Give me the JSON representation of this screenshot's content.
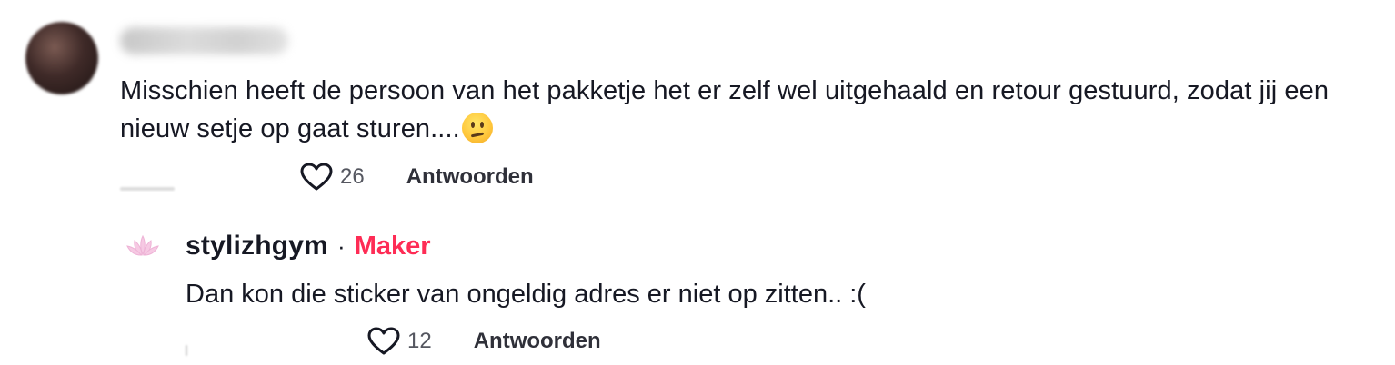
{
  "comment": {
    "text_main": "Misschien heeft de persoon van het pakketje het er zelf wel uitgehaald en retour gestuurd, zodat jij een nieuw setje op gaat sturen....",
    "emoji": "confused-face",
    "likes": "26",
    "reply_label": "Antwoorden"
  },
  "reply": {
    "username": "stylizhgym",
    "separator": "·",
    "badge": "Maker",
    "text": "Dan kon die sticker van ongeldig adres er niet op zitten.. :(",
    "likes": "12",
    "reply_label": "Antwoorden"
  },
  "colors": {
    "creator_badge": "#fe2c55",
    "text_primary": "#161823",
    "text_secondary": "#555760"
  },
  "icons": {
    "like": "heart-outline-icon",
    "emoji": "confused-face-emoji"
  }
}
